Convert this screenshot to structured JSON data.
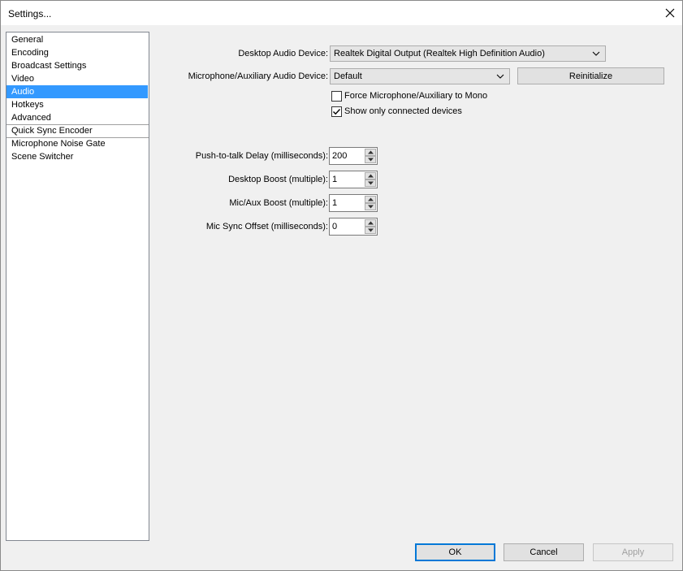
{
  "window": {
    "title": "Settings..."
  },
  "sidebar": {
    "items": [
      {
        "label": "General"
      },
      {
        "label": "Encoding"
      },
      {
        "label": "Broadcast Settings"
      },
      {
        "label": "Video"
      },
      {
        "label": "Audio",
        "selected": true
      },
      {
        "label": "Hotkeys"
      },
      {
        "label": "Advanced"
      },
      {
        "label": "Quick Sync Encoder"
      },
      {
        "label": "Microphone Noise Gate"
      },
      {
        "label": "Scene Switcher"
      }
    ]
  },
  "audio": {
    "desktop_device_label": "Desktop Audio Device:",
    "desktop_device_value": "Realtek Digital Output (Realtek High Definition Audio)",
    "mic_device_label": "Microphone/Auxiliary Audio Device:",
    "mic_device_value": "Default",
    "reinitialize_label": "Reinitialize",
    "force_mono_label": "Force Microphone/Auxiliary to Mono",
    "force_mono_checked": false,
    "connected_only_label": "Show only connected devices",
    "connected_only_checked": true,
    "ptt_delay_label": "Push-to-talk Delay (milliseconds):",
    "ptt_delay_value": "200",
    "desktop_boost_label": "Desktop Boost (multiple):",
    "desktop_boost_value": "1",
    "mic_boost_label": "Mic/Aux Boost (multiple):",
    "mic_boost_value": "1",
    "mic_sync_label": "Mic Sync Offset (milliseconds):",
    "mic_sync_value": "0"
  },
  "footer": {
    "ok_label": "OK",
    "cancel_label": "Cancel",
    "apply_label": "Apply"
  },
  "colors": {
    "selection": "#3399ff",
    "default_button_border": "#0078d7"
  }
}
